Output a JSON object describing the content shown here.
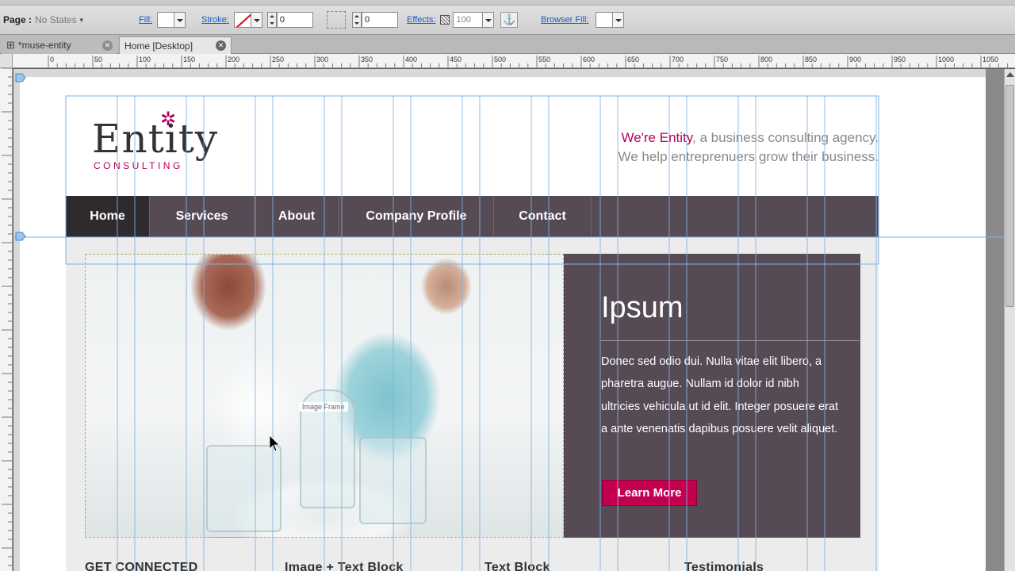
{
  "toolbar": {
    "page_label": "Page :",
    "page_states": "No States",
    "fill_label": "Fill:",
    "stroke_label": "Stroke:",
    "stroke_width": "0",
    "corner_radius": "0",
    "effects_label": "Effects:",
    "effects_opacity": "100",
    "browser_fill_label": "Browser Fill:"
  },
  "tabs": [
    {
      "label": "*muse-entity",
      "icon": "sitemap-icon"
    },
    {
      "label": "Home [Desktop]",
      "icon": ""
    }
  ],
  "ruler": {
    "h_ticks": [
      "0",
      "50",
      "100",
      "150",
      "200",
      "250",
      "300",
      "350",
      "400",
      "450",
      "500",
      "550",
      "600",
      "650",
      "700",
      "750",
      "800",
      "850",
      "900",
      "950",
      "1000",
      "1050"
    ]
  },
  "site": {
    "logo_word": "Entity",
    "logo_sub": "CONSULTING",
    "tagline_brand": "We're Entity",
    "tagline_rest": ", a business consulting agency.",
    "tagline_line2": "We help entreprenuers grow their business.",
    "nav": [
      "Home",
      "Services",
      "About",
      "Company Profile",
      "Contact"
    ],
    "image_frame_label": "Image Frame",
    "hero_title": "Ipsum",
    "hero_text": "Donec sed odio dui. Nulla vitae elit libero, a pharetra augue. Nullam id dolor id nibh ultricies vehicula ut id elit. Integer posuere erat a ante venenatis dapibus posuere velit aliquet.",
    "hero_button": "Learn More",
    "columns": [
      "GET CONNECTED",
      "Image + Text Block",
      "Text Block",
      "Testimonials"
    ]
  },
  "colors": {
    "brand": "#b5005b",
    "nav_bg": "#564b55",
    "nav_active": "#2e2a2e",
    "button": "#c2004f",
    "guide": "#7fb2e6"
  }
}
